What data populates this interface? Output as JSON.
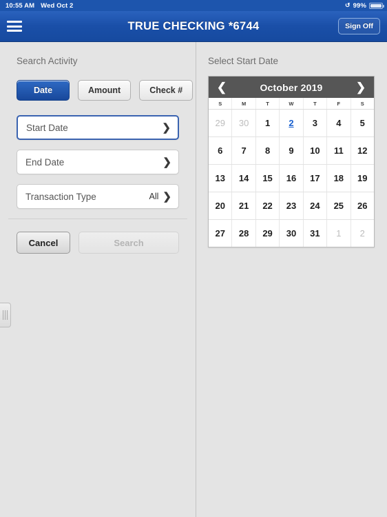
{
  "status_bar": {
    "time": "10:55 AM",
    "date": "Wed Oct 2",
    "battery_pct": "99%",
    "rotation_lock_icon": "rotation-lock-icon",
    "battery_icon": "battery-icon"
  },
  "nav": {
    "menu_icon": "hamburger-menu-icon",
    "title": "TRUE CHECKING *6744",
    "sign_off_label": "Sign Off"
  },
  "left_panel": {
    "heading": "Search Activity",
    "segments": [
      {
        "label": "Date",
        "selected": true
      },
      {
        "label": "Amount",
        "selected": false
      },
      {
        "label": "Check #",
        "selected": false
      }
    ],
    "fields": [
      {
        "label": "Start Date",
        "value": "",
        "active": true,
        "chevron": "chevron-right-icon"
      },
      {
        "label": "End Date",
        "value": "",
        "active": false,
        "chevron": "chevron-right-icon"
      },
      {
        "label": "Transaction Type",
        "value": "All",
        "active": false,
        "chevron": "chevron-right-icon"
      }
    ],
    "cancel_label": "Cancel",
    "search_label": "Search",
    "search_enabled": false,
    "drag_handle": "panel-resize-handle"
  },
  "right_panel": {
    "heading": "Select Start Date",
    "calendar": {
      "month_title": "October 2019",
      "prev_icon": "chevron-left-icon",
      "next_icon": "chevron-right-icon",
      "day_headers": [
        "S",
        "M",
        "T",
        "W",
        "T",
        "F",
        "S"
      ],
      "weeks": [
        [
          {
            "d": "29",
            "muted": true
          },
          {
            "d": "30",
            "muted": true
          },
          {
            "d": "1"
          },
          {
            "d": "2",
            "selected": true
          },
          {
            "d": "3"
          },
          {
            "d": "4"
          },
          {
            "d": "5"
          }
        ],
        [
          {
            "d": "6"
          },
          {
            "d": "7"
          },
          {
            "d": "8"
          },
          {
            "d": "9"
          },
          {
            "d": "10"
          },
          {
            "d": "11"
          },
          {
            "d": "12"
          }
        ],
        [
          {
            "d": "13"
          },
          {
            "d": "14"
          },
          {
            "d": "15"
          },
          {
            "d": "16"
          },
          {
            "d": "17"
          },
          {
            "d": "18"
          },
          {
            "d": "19"
          }
        ],
        [
          {
            "d": "20"
          },
          {
            "d": "21"
          },
          {
            "d": "22"
          },
          {
            "d": "23"
          },
          {
            "d": "24"
          },
          {
            "d": "25"
          },
          {
            "d": "26"
          }
        ],
        [
          {
            "d": "27"
          },
          {
            "d": "28"
          },
          {
            "d": "29"
          },
          {
            "d": "30"
          },
          {
            "d": "31"
          },
          {
            "d": "1",
            "muted": true
          },
          {
            "d": "2",
            "muted": true
          }
        ]
      ]
    }
  },
  "colors": {
    "brand_blue": "#1a4fa8",
    "status_blue": "#1d55ad",
    "selected_day": "#1960cf",
    "calendar_header": "#565656",
    "page_bg": "#e4e4e4"
  }
}
